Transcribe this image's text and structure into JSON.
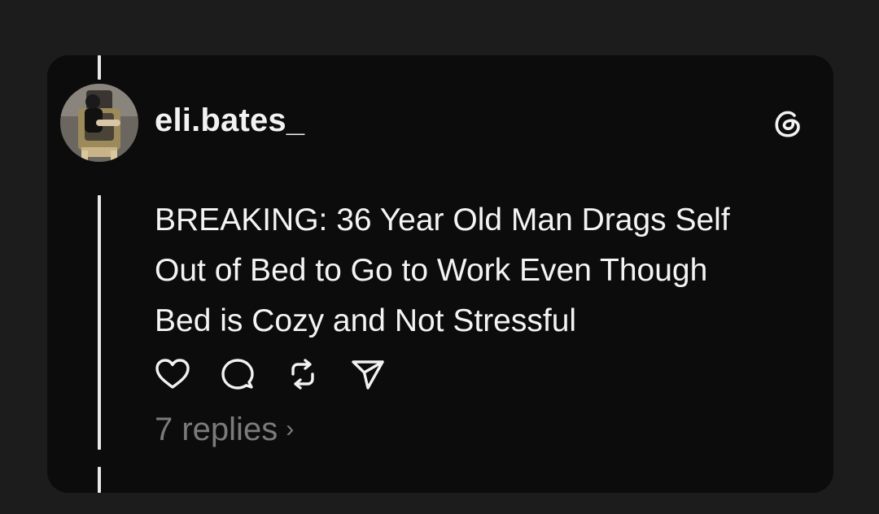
{
  "post": {
    "username": "eli.bates_",
    "avatar_icon": "profile-avatar",
    "app_icon": "threads-logo-icon",
    "text_lines": [
      "BREAKING: 36 Year Old Man Drags Self",
      "Out of Bed to Go to Work Even Though",
      "Bed is Cozy and Not Stressful"
    ],
    "actions": {
      "like_icon": "heart-icon",
      "reply_icon": "comment-icon",
      "repost_icon": "repost-icon",
      "share_icon": "send-icon"
    },
    "replies_label": "7 replies",
    "replies_chevron": "›"
  },
  "colors": {
    "background": "#1c1c1c",
    "card": "#0c0c0c",
    "text": "#f4f4f4",
    "muted": "#7b7b7b",
    "thread_line": "#e9e9e9"
  }
}
